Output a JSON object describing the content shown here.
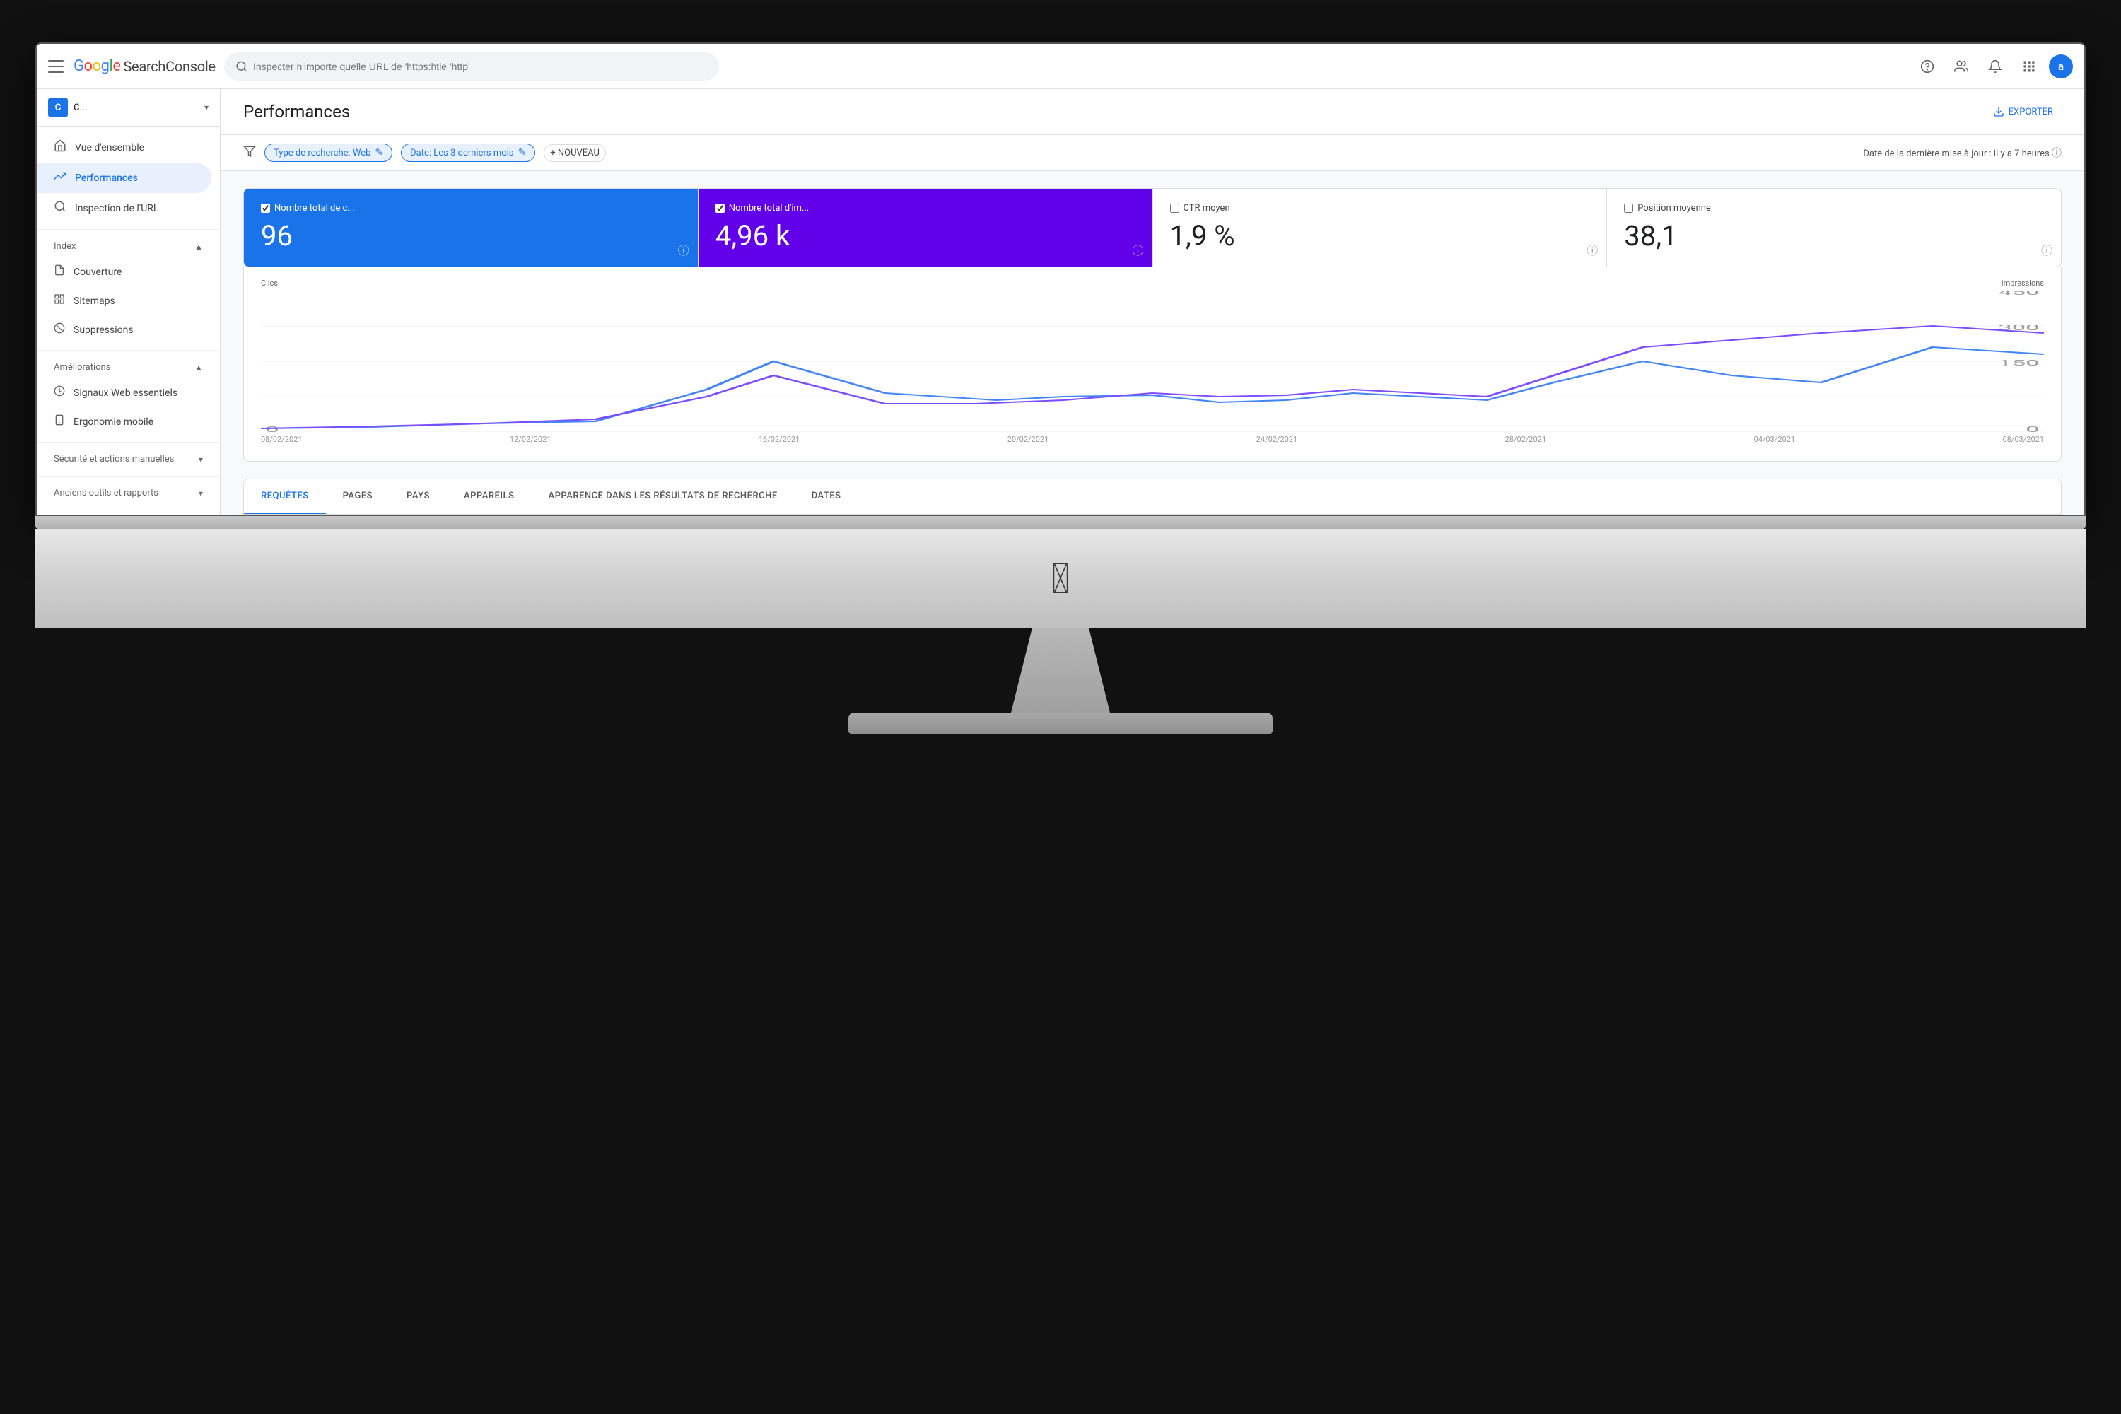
{
  "app": {
    "title": "Google Search Console",
    "logo": {
      "google": "Google",
      "sc": "SearchConsole"
    }
  },
  "header": {
    "menu_label": "Menu",
    "search_placeholder": "Inspecter n'importe quelle URL de 'https:htle 'http'",
    "help_label": "Aide",
    "account_label": "Compte",
    "notifications_label": "Notifications",
    "apps_label": "Applications",
    "avatar_letter": "a"
  },
  "sidebar": {
    "property_letter": "C",
    "property_name": "C...",
    "nav_items": [
      {
        "id": "overview",
        "label": "Vue d'ensemble",
        "icon": "🏠"
      },
      {
        "id": "performances",
        "label": "Performances",
        "icon": "📈",
        "active": true
      },
      {
        "id": "url-inspection",
        "label": "Inspection de l'URL",
        "icon": "🔍"
      }
    ],
    "index_section": {
      "label": "Index",
      "items": [
        {
          "id": "coverage",
          "label": "Couverture",
          "icon": "📄"
        },
        {
          "id": "sitemaps",
          "label": "Sitemaps",
          "icon": "🗂"
        },
        {
          "id": "suppressions",
          "label": "Suppressions",
          "icon": "🚫"
        }
      ]
    },
    "ameliorations_section": {
      "label": "Améliorations",
      "items": [
        {
          "id": "web-vitals",
          "label": "Signaux Web essentiels",
          "icon": "⚡"
        },
        {
          "id": "mobile",
          "label": "Ergonomie mobile",
          "icon": "📱"
        }
      ]
    },
    "security_section": {
      "label": "Sécurité et actions manuelles",
      "collapsed": true
    },
    "tools_section": {
      "label": "Anciens outils et rapports",
      "collapsed": true
    }
  },
  "page": {
    "title": "Performances",
    "export_label": "EXPORTER",
    "last_update": "Date de la dernière mise à jour : il y a 7 heures"
  },
  "filters": {
    "filter_icon": "filter",
    "chips": [
      {
        "id": "search-type",
        "label": "Type de recherche: Web",
        "editable": true
      },
      {
        "id": "date",
        "label": "Date: Les 3 derniers mois",
        "editable": true
      }
    ],
    "new_label": "+ NOUVEAU"
  },
  "metrics": [
    {
      "id": "clicks",
      "label": "Nombre total de c...",
      "value": "96",
      "active": true,
      "style": "blue",
      "checked": true
    },
    {
      "id": "impressions",
      "label": "Nombre total d'im...",
      "value": "4,96 k",
      "active": true,
      "style": "purple",
      "checked": true
    },
    {
      "id": "ctr",
      "label": "CTR moyen",
      "value": "1,9 %",
      "active": false,
      "style": "default",
      "checked": false
    },
    {
      "id": "position",
      "label": "Position moyenne",
      "value": "38,1",
      "active": false,
      "style": "default",
      "checked": false
    }
  ],
  "chart": {
    "left_label": "Clics",
    "right_label": "Impressions",
    "left_max": "0",
    "right_max": "450",
    "right_mid": "300",
    "right_low": "150",
    "right_zero": "0",
    "x_labels": [
      "08/02/2021",
      "12/02/2021",
      "16/02/2021",
      "20/02/2021",
      "24/02/2021",
      "28/02/2021",
      "04/03/2021",
      "08/03/2021"
    ]
  },
  "tabs": [
    {
      "id": "requetes",
      "label": "REQUÊTES",
      "active": true
    },
    {
      "id": "pages",
      "label": "PAGES",
      "active": false
    },
    {
      "id": "pays",
      "label": "PAYS",
      "active": false
    },
    {
      "id": "appareils",
      "label": "APPAREILS",
      "active": false
    },
    {
      "id": "apparence",
      "label": "APPARENCE DANS LES RÉSULTATS DE RECHERCHE",
      "active": false
    },
    {
      "id": "dates",
      "label": "DATES",
      "active": false
    }
  ],
  "monitor": {
    "apple_logo": ""
  }
}
